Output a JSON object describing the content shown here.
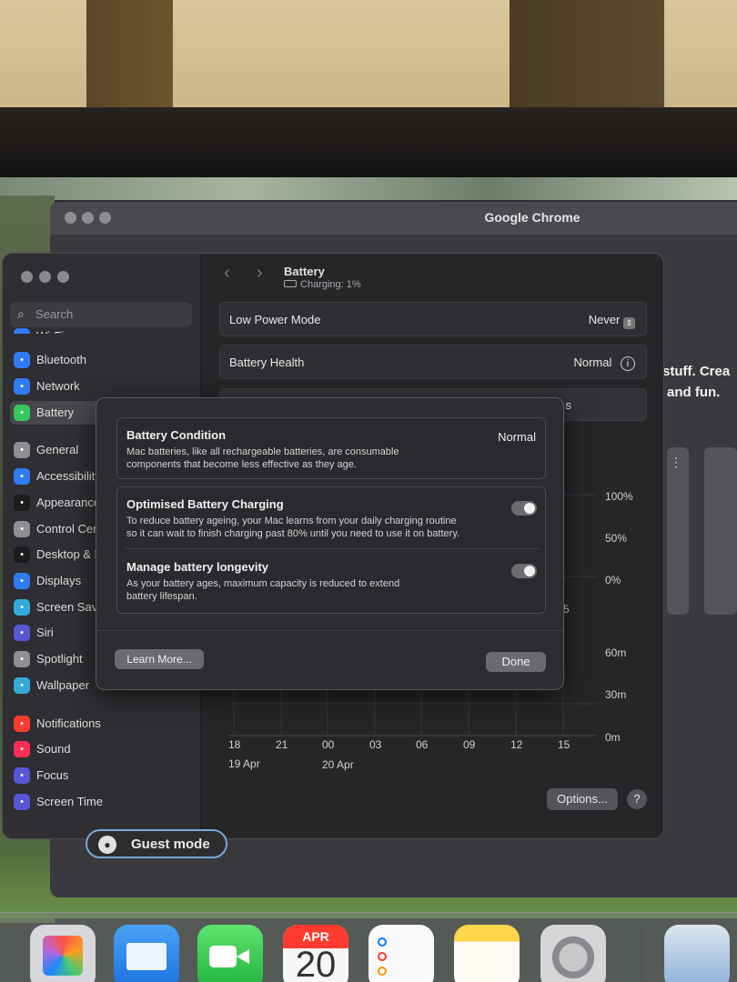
{
  "chrome": {
    "title": "Google Chrome",
    "bg_text_1": "stuff. Crea",
    "bg_text_2": "and fun.",
    "guest_label": "Guest mode"
  },
  "settings": {
    "search_placeholder": "Search",
    "sidebar": [
      {
        "label": "Wi-Fi",
        "icon": "wifi-icon",
        "color": "#2f7bf5"
      },
      {
        "label": "Bluetooth",
        "icon": "bluetooth-icon",
        "color": "#2f7bf5"
      },
      {
        "label": "Network",
        "icon": "network-icon",
        "color": "#2f7bf5"
      },
      {
        "label": "Battery",
        "icon": "battery-icon",
        "color": "#34c759"
      },
      {
        "label": "General",
        "icon": "gear-icon",
        "color": "#8e8e93"
      },
      {
        "label": "Accessibility",
        "icon": "accessibility-icon",
        "color": "#2f7bf5"
      },
      {
        "label": "Appearance",
        "icon": "appearance-icon",
        "color": "#1c1c1e"
      },
      {
        "label": "Control Centre",
        "icon": "control-centre-icon",
        "color": "#8e8e93"
      },
      {
        "label": "Desktop & Dock",
        "icon": "desktop-icon",
        "color": "#1c1c1e"
      },
      {
        "label": "Displays",
        "icon": "displays-icon",
        "color": "#2f7bf5"
      },
      {
        "label": "Screen Saver",
        "icon": "screensaver-icon",
        "color": "#34aadc"
      },
      {
        "label": "Siri",
        "icon": "siri-icon",
        "color": "#5856d6"
      },
      {
        "label": "Spotlight",
        "icon": "spotlight-icon",
        "color": "#8e8e93"
      },
      {
        "label": "Wallpaper",
        "icon": "wallpaper-icon",
        "color": "#34aadc"
      },
      {
        "label": "Notifications",
        "icon": "notifications-icon",
        "color": "#ff3b30"
      },
      {
        "label": "Sound",
        "icon": "sound-icon",
        "color": "#ff2d55"
      },
      {
        "label": "Focus",
        "icon": "focus-icon",
        "color": "#5856d6"
      },
      {
        "label": "Screen Time",
        "icon": "screen-time-icon",
        "color": "#5856d6"
      }
    ],
    "header": {
      "title": "Battery",
      "status": "Charging: 1%"
    },
    "rows": [
      {
        "label": "Low Power Mode",
        "value": "Never"
      },
      {
        "label": "Battery Health",
        "value": "Normal"
      }
    ],
    "chart": {
      "y_labels_level": [
        "100%",
        "50%",
        "0%"
      ],
      "y_labels_usage": [
        "60m",
        "30m",
        "0m"
      ],
      "x_labels": [
        "18",
        "21",
        "00",
        "03",
        "06",
        "09",
        "12",
        "15"
      ],
      "date_labels": [
        "19 Apr",
        "20 Apr"
      ],
      "partial_tab": "s",
      "partial_num": "5"
    },
    "options_label": "Options...",
    "help_label": "?"
  },
  "dialog": {
    "condition": {
      "title": "Battery Condition",
      "value": "Normal",
      "desc_1": "Mac batteries, like all rechargeable batteries, are consumable",
      "desc_2": "components that become less effective as they age."
    },
    "optimised": {
      "title": "Optimised Battery Charging",
      "desc_1": "To reduce battery ageing, your Mac learns from your daily charging routine",
      "desc_2": "so it can wait to finish charging past 80% until you need to use it on battery.",
      "enabled": true
    },
    "longevity": {
      "title": "Manage battery longevity",
      "desc_1": "As your battery ages, maximum capacity is reduced to extend",
      "desc_2": "battery lifespan.",
      "enabled": true
    },
    "learn_more": "Learn More...",
    "done": "Done"
  },
  "dock": {
    "calendar_month": "APR",
    "calendar_day": "20",
    "apps": [
      "launchpad-icon",
      "mail-icon",
      "facetime-icon",
      "calendar-icon",
      "reminders-icon",
      "notes-icon",
      "system-settings-icon",
      "preview-icon"
    ]
  }
}
